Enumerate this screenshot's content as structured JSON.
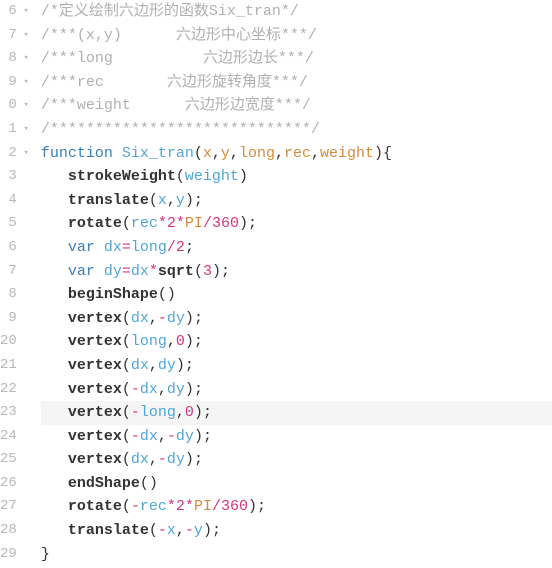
{
  "gutter": {
    "lines": [
      {
        "num": "6",
        "fold": "▾"
      },
      {
        "num": "7",
        "fold": "▾"
      },
      {
        "num": "8",
        "fold": "▾"
      },
      {
        "num": "9",
        "fold": "▾"
      },
      {
        "num": "0",
        "fold": "▾"
      },
      {
        "num": "1",
        "fold": "▾"
      },
      {
        "num": "2",
        "fold": "▾"
      },
      {
        "num": "3",
        "fold": ""
      },
      {
        "num": "4",
        "fold": ""
      },
      {
        "num": "5",
        "fold": ""
      },
      {
        "num": "6",
        "fold": ""
      },
      {
        "num": "7",
        "fold": ""
      },
      {
        "num": "8",
        "fold": ""
      },
      {
        "num": "9",
        "fold": ""
      },
      {
        "num": "20",
        "fold": ""
      },
      {
        "num": "21",
        "fold": ""
      },
      {
        "num": "22",
        "fold": ""
      },
      {
        "num": "23",
        "fold": ""
      },
      {
        "num": "24",
        "fold": ""
      },
      {
        "num": "25",
        "fold": ""
      },
      {
        "num": "26",
        "fold": ""
      },
      {
        "num": "27",
        "fold": ""
      },
      {
        "num": "28",
        "fold": ""
      },
      {
        "num": "29",
        "fold": ""
      }
    ]
  },
  "code": {
    "c0": "/*定义绘制六边形的函数Six_tran*/",
    "c1": "/***(x,y)      六边形中心坐标***/",
    "c2": "/***long          六边形边长***/",
    "c3": "/***rec       六边形旋转角度***/",
    "c4": "/***weight      六边形边宽度***/",
    "c5": "/*****************************/",
    "kw_function": "function",
    "fn_name": "Six_tran",
    "p_x": "x",
    "p_y": "y",
    "p_long": "long",
    "p_rec": "rec",
    "p_weight": "weight",
    "comma": ",",
    "lparen": "(",
    "rparen": ")",
    "lbrace": "{",
    "rbrace": "}",
    "semi": ";",
    "fn_strokeWeight": "strokeWeight",
    "fn_translate": "translate",
    "fn_rotate": "rotate",
    "fn_beginShape": "beginShape",
    "fn_vertex": "vertex",
    "fn_endShape": "endShape",
    "fn_sqrt": "sqrt",
    "kw_var": "var",
    "id_dx": "dx",
    "id_dy": "dy",
    "op_eq": "=",
    "op_mul": "*",
    "op_div": "/",
    "op_minus": "-",
    "num_2": "2",
    "num_360": "360",
    "num_0": "0",
    "num_3": "3",
    "const_PI": "PI",
    "id_rec": "rec",
    "id_long": "long",
    "id_weight": "weight",
    "id_x": "x",
    "id_y": "y",
    "indent1": "   ",
    "space": " "
  },
  "highlighted_line_index": 17
}
